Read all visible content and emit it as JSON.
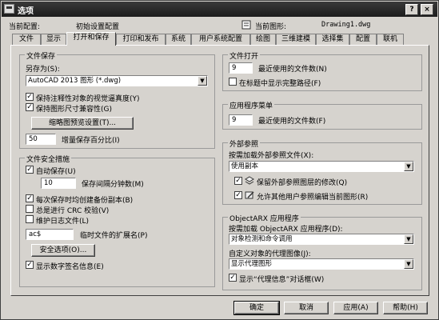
{
  "window": {
    "title": "选项",
    "help_label": "?",
    "close_label": "×"
  },
  "header": {
    "profile_label": "当前配置:",
    "profile_value": "初始设置配置",
    "drawing_label": "当前图形:",
    "drawing_value": "Drawing1.dwg"
  },
  "tabs": [
    {
      "label": "文件"
    },
    {
      "label": "显示"
    },
    {
      "label": "打开和保存"
    },
    {
      "label": "打印和发布"
    },
    {
      "label": "系统"
    },
    {
      "label": "用户系统配置"
    },
    {
      "label": "绘图"
    },
    {
      "label": "三维建模"
    },
    {
      "label": "选择集"
    },
    {
      "label": "配置"
    },
    {
      "label": "联机"
    }
  ],
  "file_save": {
    "title": "文件保存",
    "save_as_label": "另存为(S):",
    "save_as_value": "AutoCAD 2013 图形 (*.dwg)",
    "maintain_visual_fidelity": {
      "label": "保持注释性对象的视觉逼真度(Y)",
      "checked": true
    },
    "maintain_drawing_size": {
      "label": "保持图形尺寸兼容性(G)",
      "checked": true
    },
    "thumbnail_button": "缩略图预览设置(T)...",
    "incremental_value": "50",
    "incremental_label": "增量保存百分比(I)"
  },
  "file_safety": {
    "title": "文件安全措施",
    "autosave": {
      "label": "自动保存(U)",
      "checked": true
    },
    "autosave_minutes_value": "10",
    "autosave_minutes_label": "保存间隔分钟数(M)",
    "backup_copy": {
      "label": "每次保存时均创建备份副本(B)",
      "checked": true
    },
    "crc_check": {
      "label": "总是进行 CRC 校验(V)",
      "checked": false
    },
    "log_file": {
      "label": "维护日志文件(L)",
      "checked": false
    },
    "temp_ext_value": "ac$",
    "temp_ext_label": "临时文件的扩展名(P)",
    "security_button": "安全选项(O)...",
    "digital_signature": {
      "label": "显示数字签名信息(E)",
      "checked": true
    }
  },
  "file_open": {
    "title": "文件打开",
    "recent_value": "9",
    "recent_label": "最近使用的文件数(N)",
    "full_path": {
      "label": "在标题中显示完整路径(F)",
      "checked": false
    }
  },
  "app_menu": {
    "title": "应用程序菜单",
    "recent_value": "9",
    "recent_label": "最近使用的文件数(F)"
  },
  "xref": {
    "title": "外部参照",
    "demand_load_label": "按需加载外部参照文件(X):",
    "demand_load_value": "使用副本",
    "retain_changes": {
      "label": "保留外部参照图层的修改(Q)",
      "checked": true
    },
    "allow_edit": {
      "label": "允许其他用户参照编辑当前图形(R)",
      "checked": true
    }
  },
  "objectarx": {
    "title": "ObjectARX 应用程序",
    "demand_load_label": "按需加载 ObjectARX 应用程序(D):",
    "demand_load_value": "对象检测和命令调用",
    "proxy_images_label": "自定义对象的代理图像(J):",
    "proxy_images_value": "显示代理图形",
    "proxy_dialog": {
      "label": "显示“代理信息”对话框(W)",
      "checked": true
    }
  },
  "footer": {
    "ok": "确定",
    "cancel": "取消",
    "apply": "应用(A)",
    "help": "帮助(H)"
  }
}
